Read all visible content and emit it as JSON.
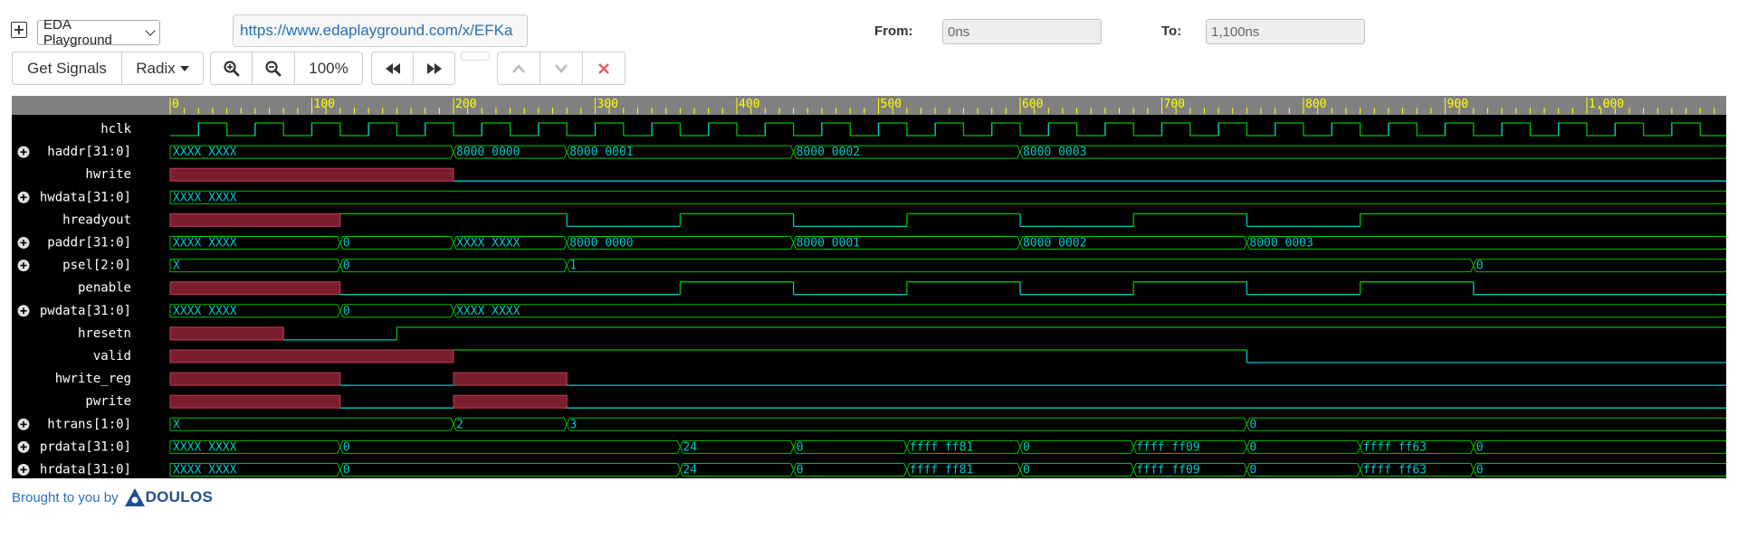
{
  "header": {
    "expand_symbol": "+",
    "site_select": "EDA Playground",
    "url": "https://www.edaplayground.com/x/EFKa",
    "from_label": "From:",
    "from_value": "0ns",
    "to_label": "To:",
    "to_value": "1,100ns"
  },
  "toolbar": {
    "get_signals": "Get Signals",
    "radix": "Radix",
    "zoom_level": "100%"
  },
  "footer": {
    "brought_by": "Brought to you by",
    "brand": "DOULOS"
  },
  "waveform": {
    "time_range_ns": [
      0,
      1100
    ],
    "ticks": [
      "0",
      "100",
      "200",
      "300",
      "400",
      "500",
      "600",
      "700",
      "800",
      "900",
      "1,000"
    ],
    "clock_period_ns": 40,
    "colors": {
      "green": "#00c000",
      "cyan": "#00c8c8",
      "x_fill": "#7a1e2e",
      "x_stroke": "#c23c52",
      "label": "#ffffff",
      "scale_text": "#ffff00"
    },
    "signals": [
      {
        "name": "hclk",
        "bus": false,
        "clock": true
      },
      {
        "name": "haddr[31:0]",
        "bus": true,
        "segments": [
          [
            0,
            200,
            "XXXX_XXXX"
          ],
          [
            200,
            280,
            "8000_0000"
          ],
          [
            280,
            440,
            "8000_0001"
          ],
          [
            440,
            600,
            "8000_0002"
          ],
          [
            600,
            1100,
            "8000_0003"
          ]
        ]
      },
      {
        "name": "hwrite",
        "bus": false,
        "segments": [
          [
            0,
            200,
            "x"
          ],
          [
            200,
            1100,
            "0"
          ]
        ]
      },
      {
        "name": "hwdata[31:0]",
        "bus": true,
        "segments": [
          [
            0,
            1100,
            "XXXX_XXXX"
          ]
        ]
      },
      {
        "name": "hreadyout",
        "bus": false,
        "segments": [
          [
            0,
            120,
            "x"
          ],
          [
            120,
            280,
            "1"
          ],
          [
            280,
            360,
            "0"
          ],
          [
            360,
            440,
            "1"
          ],
          [
            440,
            520,
            "0"
          ],
          [
            520,
            600,
            "1"
          ],
          [
            600,
            680,
            "0"
          ],
          [
            680,
            760,
            "1"
          ],
          [
            760,
            840,
            "0"
          ],
          [
            840,
            1100,
            "1"
          ]
        ]
      },
      {
        "name": "paddr[31:0]",
        "bus": true,
        "segments": [
          [
            0,
            120,
            "XXXX_XXXX"
          ],
          [
            120,
            200,
            "0"
          ],
          [
            200,
            280,
            "XXXX_XXXX"
          ],
          [
            280,
            440,
            "8000_0000"
          ],
          [
            440,
            600,
            "8000_0001"
          ],
          [
            600,
            760,
            "8000_0002"
          ],
          [
            760,
            1100,
            "8000_0003"
          ]
        ]
      },
      {
        "name": "psel[2:0]",
        "bus": true,
        "segments": [
          [
            0,
            120,
            "X"
          ],
          [
            120,
            280,
            "0"
          ],
          [
            280,
            920,
            "1"
          ],
          [
            920,
            1100,
            "0"
          ]
        ]
      },
      {
        "name": "penable",
        "bus": false,
        "segments": [
          [
            0,
            120,
            "x"
          ],
          [
            120,
            360,
            "0"
          ],
          [
            360,
            440,
            "1"
          ],
          [
            440,
            520,
            "0"
          ],
          [
            520,
            600,
            "1"
          ],
          [
            600,
            680,
            "0"
          ],
          [
            680,
            760,
            "1"
          ],
          [
            760,
            840,
            "0"
          ],
          [
            840,
            920,
            "1"
          ],
          [
            920,
            1100,
            "0"
          ]
        ]
      },
      {
        "name": "pwdata[31:0]",
        "bus": true,
        "segments": [
          [
            0,
            120,
            "XXXX_XXXX"
          ],
          [
            120,
            200,
            "0"
          ],
          [
            200,
            1100,
            "XXXX_XXXX"
          ]
        ]
      },
      {
        "name": "hresetn",
        "bus": false,
        "segments": [
          [
            0,
            80,
            "x"
          ],
          [
            80,
            160,
            "0"
          ],
          [
            160,
            1100,
            "1"
          ]
        ]
      },
      {
        "name": "valid",
        "bus": false,
        "segments": [
          [
            0,
            200,
            "x"
          ],
          [
            200,
            760,
            "1"
          ],
          [
            760,
            1100,
            "0"
          ]
        ]
      },
      {
        "name": "hwrite_reg",
        "bus": false,
        "segments": [
          [
            0,
            120,
            "x"
          ],
          [
            120,
            200,
            "0"
          ],
          [
            200,
            280,
            "x"
          ],
          [
            280,
            1100,
            "0"
          ]
        ]
      },
      {
        "name": "pwrite",
        "bus": false,
        "segments": [
          [
            0,
            120,
            "x"
          ],
          [
            120,
            200,
            "0"
          ],
          [
            200,
            280,
            "x"
          ],
          [
            280,
            1100,
            "0"
          ]
        ]
      },
      {
        "name": "htrans[1:0]",
        "bus": true,
        "segments": [
          [
            0,
            200,
            "X"
          ],
          [
            200,
            280,
            "2"
          ],
          [
            280,
            760,
            "3"
          ],
          [
            760,
            1100,
            "0"
          ]
        ]
      },
      {
        "name": "prdata[31:0]",
        "bus": true,
        "segments": [
          [
            0,
            120,
            "XXXX_XXXX"
          ],
          [
            120,
            360,
            "0"
          ],
          [
            360,
            440,
            "24"
          ],
          [
            440,
            520,
            "0"
          ],
          [
            520,
            600,
            "ffff_ff81"
          ],
          [
            600,
            680,
            "0"
          ],
          [
            680,
            760,
            "ffff_ff09"
          ],
          [
            760,
            840,
            "0"
          ],
          [
            840,
            920,
            "ffff_ff63"
          ],
          [
            920,
            1100,
            "0"
          ]
        ]
      },
      {
        "name": "hrdata[31:0]",
        "bus": true,
        "segments": [
          [
            0,
            120,
            "XXXX_XXXX"
          ],
          [
            120,
            360,
            "0"
          ],
          [
            360,
            440,
            "24"
          ],
          [
            440,
            520,
            "0"
          ],
          [
            520,
            600,
            "ffff_ff81"
          ],
          [
            600,
            680,
            "0"
          ],
          [
            680,
            760,
            "ffff_ff09"
          ],
          [
            760,
            840,
            "0"
          ],
          [
            840,
            920,
            "ffff_ff63"
          ],
          [
            920,
            1100,
            "0"
          ]
        ]
      }
    ]
  }
}
